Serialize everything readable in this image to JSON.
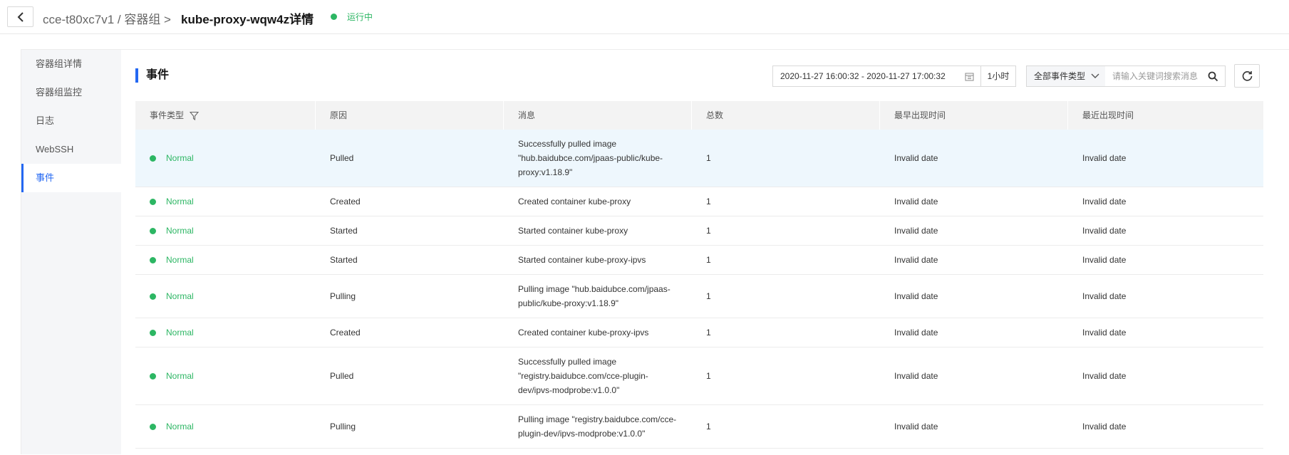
{
  "header": {
    "breadcrumb_parent": "cce-t80xc7v1 / 容器组 >",
    "title": "kube-proxy-wqw4z详情",
    "status": "运行中",
    "status_color": "#2cb663"
  },
  "sidebar": {
    "items": [
      {
        "label": "容器组详情"
      },
      {
        "label": "容器组监控"
      },
      {
        "label": "日志"
      },
      {
        "label": "WebSSH"
      },
      {
        "label": "事件"
      }
    ],
    "active_index": 4
  },
  "toolbar": {
    "section_title": "事件",
    "time_range": "2020-11-27 16:00:32 - 2020-11-27 17:00:32",
    "quick_range": "1小时",
    "event_type_selected": "全部事件类型",
    "search_placeholder": "请输入关键词搜索消息"
  },
  "table": {
    "headers": [
      "事件类型",
      "原因",
      "消息",
      "总数",
      "最早出现时间",
      "最近出现时间"
    ],
    "rows": [
      {
        "type": "Normal",
        "reason": "Pulled",
        "message": "Successfully pulled image \"hub.baidubce.com/jpaas-public/kube-proxy:v1.18.9\"",
        "count": "1",
        "first": "Invalid date",
        "last": "Invalid date"
      },
      {
        "type": "Normal",
        "reason": "Created",
        "message": "Created container kube-proxy",
        "count": "1",
        "first": "Invalid date",
        "last": "Invalid date"
      },
      {
        "type": "Normal",
        "reason": "Started",
        "message": "Started container kube-proxy",
        "count": "1",
        "first": "Invalid date",
        "last": "Invalid date"
      },
      {
        "type": "Normal",
        "reason": "Started",
        "message": "Started container kube-proxy-ipvs",
        "count": "1",
        "first": "Invalid date",
        "last": "Invalid date"
      },
      {
        "type": "Normal",
        "reason": "Pulling",
        "message": "Pulling image \"hub.baidubce.com/jpaas-public/kube-proxy:v1.18.9\"",
        "count": "1",
        "first": "Invalid date",
        "last": "Invalid date"
      },
      {
        "type": "Normal",
        "reason": "Created",
        "message": "Created container kube-proxy-ipvs",
        "count": "1",
        "first": "Invalid date",
        "last": "Invalid date"
      },
      {
        "type": "Normal",
        "reason": "Pulled",
        "message": "Successfully pulled image \"registry.baidubce.com/cce-plugin-dev/ipvs-modprobe:v1.0.0\"",
        "count": "1",
        "first": "Invalid date",
        "last": "Invalid date"
      },
      {
        "type": "Normal",
        "reason": "Pulling",
        "message": "Pulling image \"registry.baidubce.com/cce-plugin-dev/ipvs-modprobe:v1.0.0\"",
        "count": "1",
        "first": "Invalid date",
        "last": "Invalid date"
      }
    ]
  },
  "colors": {
    "accent": "#2468f2",
    "success": "#2cb663",
    "row_highlight": "#eef7fd"
  }
}
